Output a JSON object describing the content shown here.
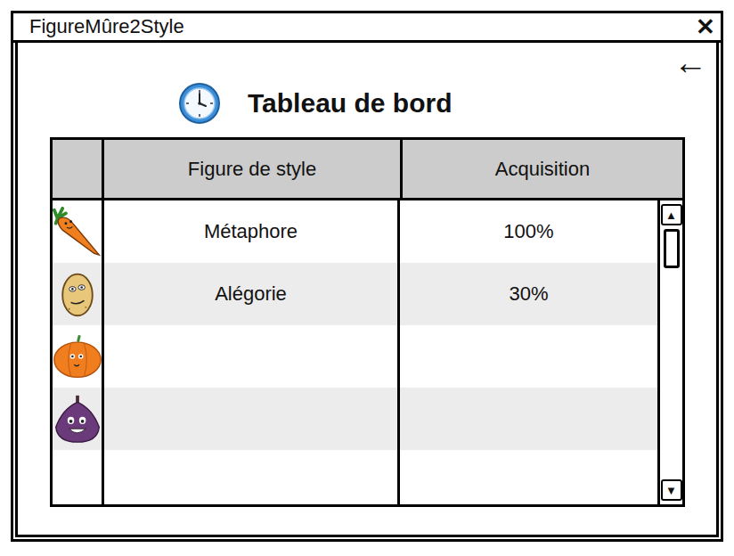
{
  "window": {
    "title": "FigureMûre2Style",
    "close": "✕"
  },
  "back": "←",
  "heading": "Tableau de bord",
  "table": {
    "columns": [
      "Figure de style",
      "Acquisition"
    ],
    "rows": [
      {
        "name": "Métaphore",
        "acquisition": "100%"
      },
      {
        "name": "Alégorie",
        "acquisition": "30%"
      },
      {
        "name": "",
        "acquisition": ""
      },
      {
        "name": "",
        "acquisition": ""
      }
    ]
  },
  "scrollbar": {
    "up": "▲",
    "down": "▼",
    "level": 0
  }
}
